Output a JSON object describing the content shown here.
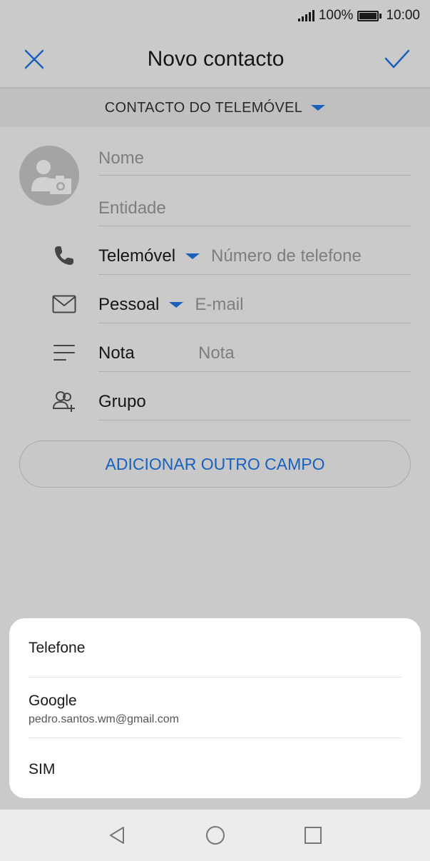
{
  "status_bar": {
    "battery_percent": "100%",
    "time": "10:00"
  },
  "app_bar": {
    "title": "Novo contacto",
    "close_icon": "close-icon",
    "confirm_icon": "check-icon"
  },
  "account_selector": {
    "label": "CONTACTO DO TELEMÓVEL"
  },
  "form": {
    "name_placeholder": "Nome",
    "entity_placeholder": "Entidade",
    "phone": {
      "type_label": "Telemóvel",
      "placeholder": "Número de telefone"
    },
    "email": {
      "type_label": "Pessoal",
      "placeholder": "E-mail"
    },
    "note": {
      "label": "Nota",
      "placeholder": "Nota"
    },
    "group": {
      "label": "Grupo"
    },
    "add_field_button": "ADICIONAR OUTRO CAMPO"
  },
  "account_sheet": {
    "items": [
      {
        "name": "Telefone"
      },
      {
        "name": "Google",
        "sub": "pedro.santos.wm@gmail.com"
      },
      {
        "name": "SIM"
      }
    ]
  },
  "colors": {
    "accent": "#1f77e6",
    "background": "#f7f7f7"
  }
}
